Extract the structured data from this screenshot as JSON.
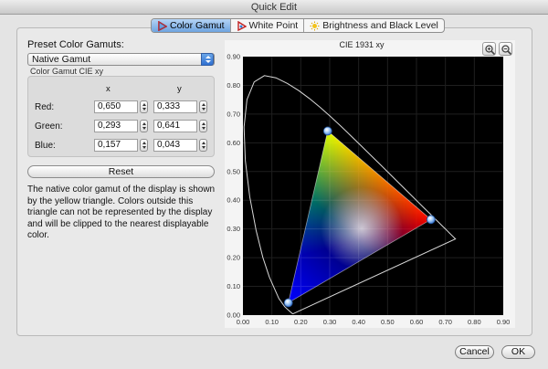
{
  "window": {
    "title": "Quick Edit"
  },
  "tabs": [
    {
      "label": "Color Gamut",
      "icon": "gamut-icon",
      "active": true
    },
    {
      "label": "White Point",
      "icon": "white-point-icon",
      "active": false
    },
    {
      "label": "Brightness and Black Level",
      "icon": "brightness-icon",
      "active": false
    }
  ],
  "preset": {
    "label": "Preset Color Gamuts:",
    "selected": "Native Gamut"
  },
  "gamut_group": {
    "title": "Color Gamut CIE xy",
    "col_x": "x",
    "col_y": "y",
    "rows": [
      {
        "label": "Red:",
        "x": "0,650",
        "y": "0,333"
      },
      {
        "label": "Green:",
        "x": "0,293",
        "y": "0,641"
      },
      {
        "label": "Blue:",
        "x": "0,157",
        "y": "0,043"
      }
    ]
  },
  "reset_label": "Reset",
  "description": "The native color gamut of the display is shown by the yellow triangle. Colors outside this triangle can not be represented by the display and will be clipped to the nearest displayable color.",
  "plot": {
    "title": "CIE 1931 xy",
    "x_ticks": [
      "0.00",
      "0.10",
      "0.20",
      "0.30",
      "0.40",
      "0.50",
      "0.60",
      "0.70",
      "0.80",
      "0.90"
    ],
    "y_ticks": [
      "0.00",
      "0.10",
      "0.20",
      "0.30",
      "0.40",
      "0.50",
      "0.60",
      "0.70",
      "0.80",
      "0.90"
    ],
    "zoom_in_icon": "zoom-in-icon",
    "zoom_out_icon": "zoom-out-icon",
    "background": "#000000",
    "locus_color": "#d9d9d9"
  },
  "footer": {
    "cancel": "Cancel",
    "ok": "OK"
  }
}
